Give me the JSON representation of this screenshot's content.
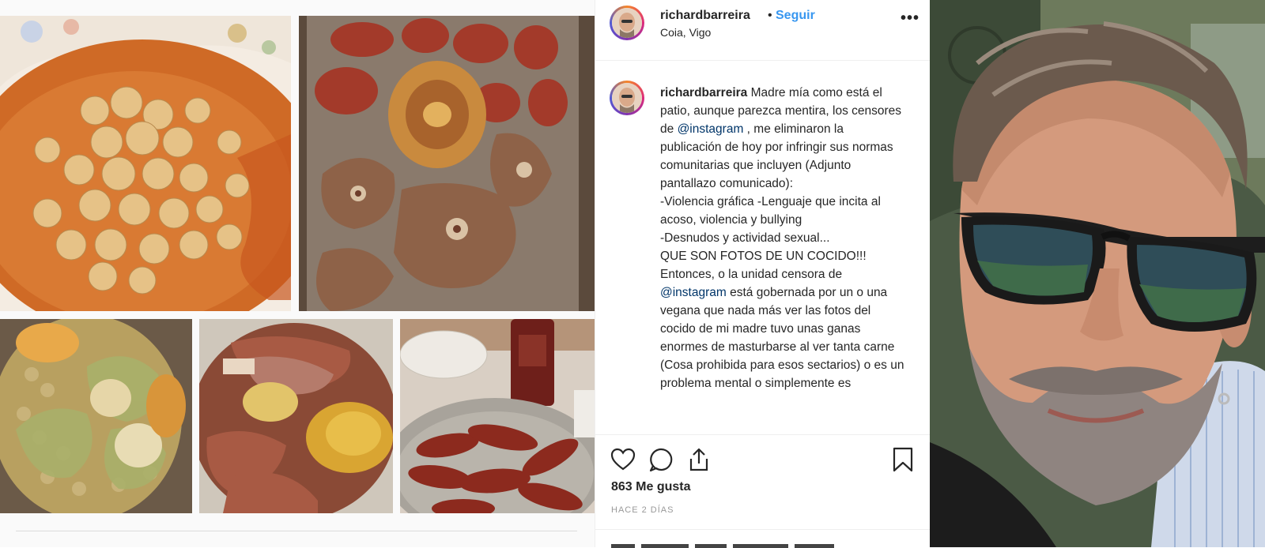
{
  "post": {
    "username": "richardbarreira",
    "header_separator": "•",
    "follow_label": "Seguir",
    "location": "Coia, Vigo",
    "more_icon": "•••",
    "caption_parts": [
      {
        "style": "username",
        "text": "richardbarreira"
      },
      {
        "style": "text",
        "text": " Madre mía como está el patio, aunque parezca mentira, los censores de "
      },
      {
        "style": "mention",
        "text": "@instagram"
      },
      {
        "style": "text",
        "text": " , me eliminaron la publicación de hoy por infringir sus normas comunitarias que incluyen (Adjunto pantallazo comunicado):"
      },
      {
        "style": "break",
        "text": ""
      },
      {
        "style": "text",
        "text": "-Violencia gráfica -Lenguaje que incita al acoso, violencia y bullying"
      },
      {
        "style": "break",
        "text": ""
      },
      {
        "style": "text",
        "text": "-Desnudos y actividad sexual..."
      },
      {
        "style": "break",
        "text": ""
      },
      {
        "style": "text",
        "text": "QUE SON FOTOS DE UN COCIDO!!!"
      },
      {
        "style": "break",
        "text": ""
      },
      {
        "style": "text",
        "text": "Entonces, o la unidad censora de "
      },
      {
        "style": "mention",
        "text": "@instagram"
      },
      {
        "style": "text",
        "text": " está gobernada por un o una vegana que nada más ver las fotos del cocido de mi madre tuvo unas ganas enormes de masturbarse al ver tanta carne (Cosa prohibida para esos sectarios) o es un problema mental o simplemente es"
      }
    ],
    "likes": "863 Me gusta",
    "time": "HACE 2 DÍAS"
  },
  "icons": {
    "like": "heart-icon",
    "comment": "comment-bubble-icon",
    "share": "share-icon",
    "bookmark": "bookmark-icon",
    "next": "chevron-right-icon"
  },
  "colors": {
    "link_blue": "#3897f0",
    "mention_blue": "#003569",
    "text": "#262626",
    "muted": "#999999"
  }
}
